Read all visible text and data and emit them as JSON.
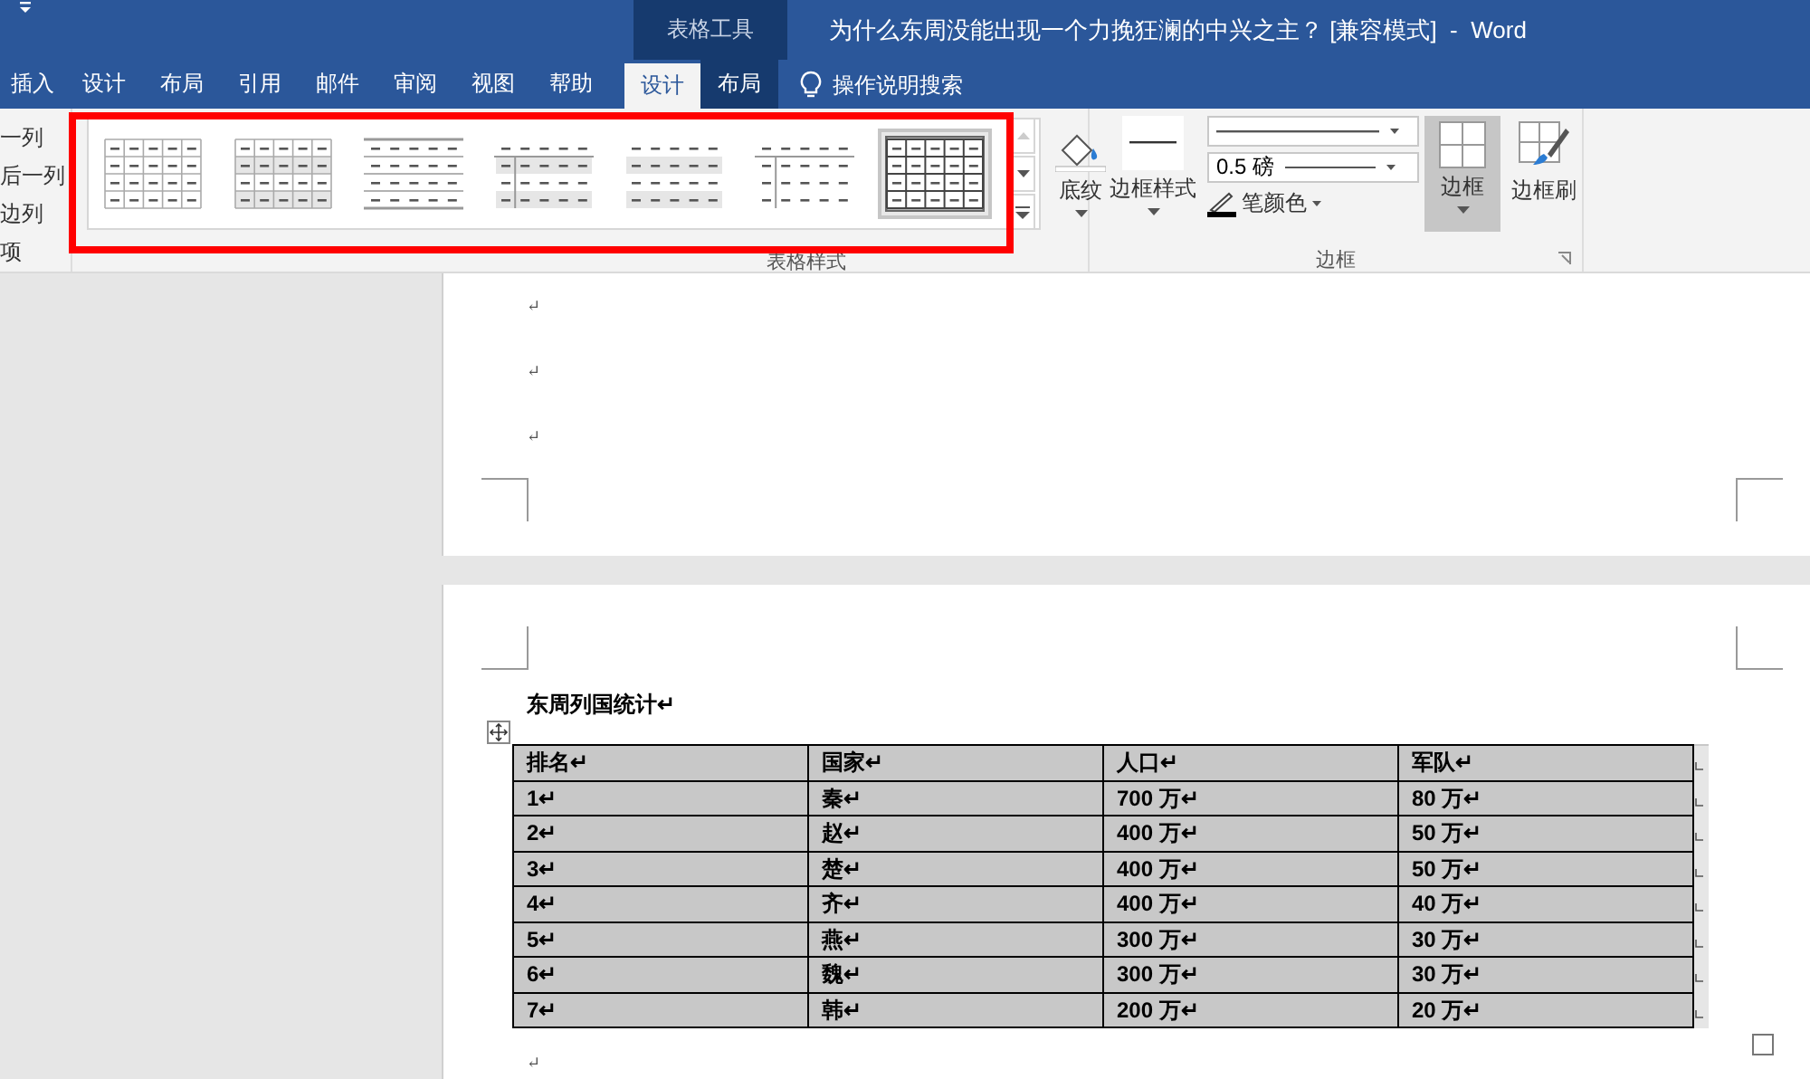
{
  "window": {
    "title": "为什么东周没能出现一个力挽狂澜的中兴之主？ [兼容模式]  -  Word",
    "contextual_label": "表格工具"
  },
  "tabs": [
    {
      "label": "插入",
      "selected": false,
      "contextual": false
    },
    {
      "label": "设计",
      "selected": false,
      "contextual": false
    },
    {
      "label": "布局",
      "selected": false,
      "contextual": false
    },
    {
      "label": "引用",
      "selected": false,
      "contextual": false
    },
    {
      "label": "邮件",
      "selected": false,
      "contextual": false
    },
    {
      "label": "审阅",
      "selected": false,
      "contextual": false
    },
    {
      "label": "视图",
      "selected": false,
      "contextual": false
    },
    {
      "label": "帮助",
      "selected": false,
      "contextual": false
    },
    {
      "label": "设计",
      "selected": true,
      "contextual": true
    },
    {
      "label": "布局",
      "selected": false,
      "contextual": true
    }
  ],
  "tell_me": {
    "placeholder": "操作说明搜索"
  },
  "style_options": [
    "一列",
    "后一列",
    "边列",
    "项"
  ],
  "table_styles": {
    "label": "表格样式",
    "items": [
      {
        "kind": "grid",
        "selected": false
      },
      {
        "kind": "grid-banded",
        "selected": false
      },
      {
        "kind": "rows",
        "selected": false
      },
      {
        "kind": "first-column-banded",
        "selected": false
      },
      {
        "kind": "banded",
        "selected": false
      },
      {
        "kind": "first-column",
        "selected": false
      },
      {
        "kind": "grid-bold",
        "selected": true
      }
    ]
  },
  "shading": {
    "label": "底纹"
  },
  "borders": {
    "label": "边框",
    "border_styles": "边框样式",
    "weight": "0.5 磅",
    "pen_color": "笔颜色",
    "borders_button": "边框",
    "borders_selected": true,
    "border_painter": "边框刷"
  },
  "document": {
    "page1_marks": [
      "↵",
      "↵",
      "↵"
    ],
    "title": "东周列国统计↵",
    "table": {
      "columns": [
        "排名↵",
        "国家↵",
        "人口↵",
        "军队↵"
      ],
      "rows": [
        [
          "1↵",
          "秦↵",
          "700 万↵",
          "80 万↵"
        ],
        [
          "2↵",
          "赵↵",
          "400 万↵",
          "50 万↵"
        ],
        [
          "3↵",
          "楚↵",
          "400 万↵",
          "50 万↵"
        ],
        [
          "4↵",
          "齐↵",
          "400 万↵",
          "40 万↵"
        ],
        [
          "5↵",
          "燕↵",
          "300 万↵",
          "30 万↵"
        ],
        [
          "6↵",
          "魏↵",
          "300 万↵",
          "30 万↵"
        ],
        [
          "7↵",
          "韩↵",
          "200 万↵",
          "20 万↵"
        ]
      ]
    },
    "after_table": "↵"
  }
}
